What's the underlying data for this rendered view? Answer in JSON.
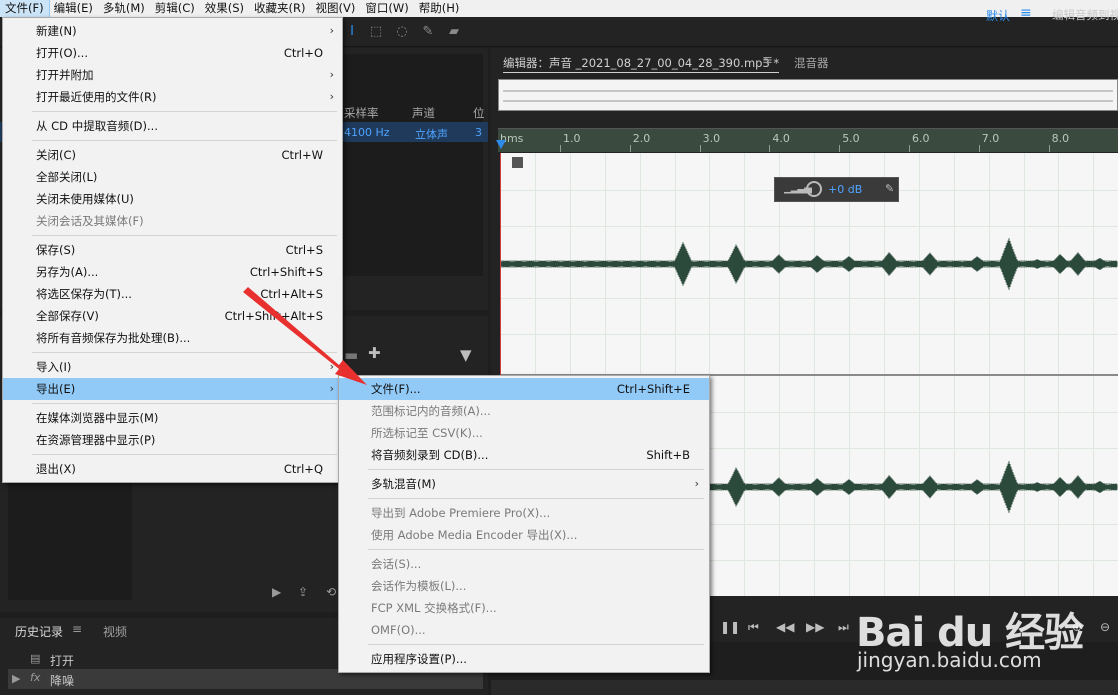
{
  "menubar": {
    "items": [
      "文件(F)",
      "编辑(E)",
      "多轨(M)",
      "剪辑(C)",
      "效果(S)",
      "收藏夹(R)",
      "视图(V)",
      "窗口(W)",
      "帮助(H)"
    ]
  },
  "toolbar": {
    "workspace_label": "默认",
    "workspace_other": "编辑音频到视"
  },
  "files_panel": {
    "columns": [
      "采样率",
      "声道",
      "位"
    ],
    "row": {
      "sample_rate": "4100 Hz",
      "channels": "立体声",
      "bits": "3"
    }
  },
  "history": {
    "tab": "历史记录",
    "video_tab": "视频",
    "entries": [
      {
        "icon": "open-file-icon",
        "label": "打开"
      },
      {
        "icon": "fx-icon",
        "icon_text": "fx",
        "label": "降噪"
      }
    ]
  },
  "editor": {
    "tab_title": "编辑器：声音 _2021_08_27_00_04_28_390.mp3 *",
    "mixer_tab": "混音器",
    "ruler_unit": "hms",
    "ruler_labels": [
      "1.0",
      "2.0",
      "3.0",
      "4.0",
      "5.0",
      "6.0",
      "7.0",
      "8.0"
    ],
    "hud_gain": "+0 dB"
  },
  "file_menu": {
    "items": [
      {
        "label": "新建(N)",
        "shortcut": "",
        "submenu": true,
        "disabled": false
      },
      {
        "label": "打开(O)...",
        "shortcut": "Ctrl+O",
        "submenu": false,
        "disabled": false
      },
      {
        "label": "打开并附加",
        "shortcut": "",
        "submenu": true,
        "disabled": false
      },
      {
        "label": "打开最近使用的文件(R)",
        "shortcut": "",
        "submenu": true,
        "disabled": false
      },
      {
        "sep": true
      },
      {
        "label": "从 CD 中提取音频(D)...",
        "shortcut": "",
        "submenu": false,
        "disabled": false
      },
      {
        "sep": true
      },
      {
        "label": "关闭(C)",
        "shortcut": "Ctrl+W",
        "submenu": false,
        "disabled": false
      },
      {
        "label": "全部关闭(L)",
        "shortcut": "",
        "submenu": false,
        "disabled": false
      },
      {
        "label": "关闭未使用媒体(U)",
        "shortcut": "",
        "submenu": false,
        "disabled": false
      },
      {
        "label": "关闭会话及其媒体(F)",
        "shortcut": "",
        "submenu": false,
        "disabled": true
      },
      {
        "sep": true
      },
      {
        "label": "保存(S)",
        "shortcut": "Ctrl+S",
        "submenu": false,
        "disabled": false
      },
      {
        "label": "另存为(A)...",
        "shortcut": "Ctrl+Shift+S",
        "submenu": false,
        "disabled": false
      },
      {
        "label": "将选区保存为(T)...",
        "shortcut": "Ctrl+Alt+S",
        "submenu": false,
        "disabled": false
      },
      {
        "label": "全部保存(V)",
        "shortcut": "Ctrl+Shift+Alt+S",
        "submenu": false,
        "disabled": false
      },
      {
        "label": "将所有音频保存为批处理(B)...",
        "shortcut": "",
        "submenu": false,
        "disabled": false
      },
      {
        "sep": true
      },
      {
        "label": "导入(I)",
        "shortcut": "",
        "submenu": true,
        "disabled": false
      },
      {
        "label": "导出(E)",
        "shortcut": "",
        "submenu": true,
        "disabled": false,
        "highlight": true
      },
      {
        "sep": true
      },
      {
        "label": "在媒体浏览器中显示(M)",
        "shortcut": "",
        "submenu": false,
        "disabled": false
      },
      {
        "label": "在资源管理器中显示(P)",
        "shortcut": "",
        "submenu": false,
        "disabled": false
      },
      {
        "sep": true
      },
      {
        "label": "退出(X)",
        "shortcut": "Ctrl+Q",
        "submenu": false,
        "disabled": false
      }
    ]
  },
  "export_menu": {
    "items": [
      {
        "label": "文件(F)...",
        "shortcut": "Ctrl+Shift+E",
        "submenu": false,
        "disabled": false,
        "highlight": true
      },
      {
        "label": "范围标记内的音频(A)...",
        "shortcut": "",
        "submenu": false,
        "disabled": true
      },
      {
        "label": "所选标记至 CSV(K)...",
        "shortcut": "",
        "submenu": false,
        "disabled": true
      },
      {
        "label": "将音频刻录到 CD(B)...",
        "shortcut": "Shift+B",
        "submenu": false,
        "disabled": false
      },
      {
        "sep": true
      },
      {
        "label": "多轨混音(M)",
        "shortcut": "",
        "submenu": true,
        "disabled": false
      },
      {
        "sep": true
      },
      {
        "label": "导出到 Adobe Premiere Pro(X)...",
        "shortcut": "",
        "submenu": false,
        "disabled": true
      },
      {
        "label": "使用 Adobe Media Encoder 导出(X)...",
        "shortcut": "",
        "submenu": false,
        "disabled": true
      },
      {
        "sep": true
      },
      {
        "label": "会话(S)...",
        "shortcut": "",
        "submenu": false,
        "disabled": true
      },
      {
        "label": "会话作为模板(L)...",
        "shortcut": "",
        "submenu": false,
        "disabled": true
      },
      {
        "label": "FCP XML 交换格式(F)...",
        "shortcut": "",
        "submenu": false,
        "disabled": true
      },
      {
        "label": "OMF(O)...",
        "shortcut": "",
        "submenu": false,
        "disabled": true
      },
      {
        "sep": true
      },
      {
        "label": "应用程序设置(P)...",
        "shortcut": "",
        "submenu": false,
        "disabled": false
      }
    ]
  },
  "watermark": {
    "logo": "Bai du 经验",
    "url": "jingyan.baidu.com"
  },
  "colors": {
    "accent": "#2d8ceb",
    "waveform": "#2c4a3c",
    "menu_highlight": "#91c9f7",
    "annotation": "#e8312f"
  }
}
